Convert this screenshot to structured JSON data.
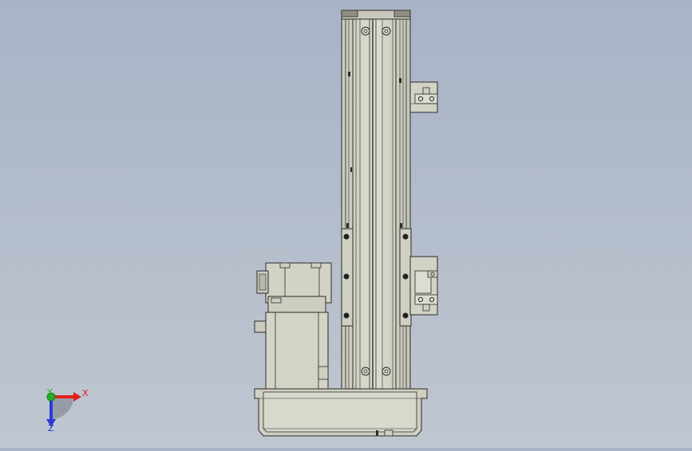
{
  "viewport": {
    "background_top": "#a8b3c6",
    "background_bottom": "#bfc6d0",
    "part_fill": "#d3d3c6",
    "part_shade": "#bdbdb0",
    "edge_color": "#2b2b2b"
  },
  "triad": {
    "x_label": "X",
    "y_label": "Y",
    "z_label": "Z",
    "x_color": "#e0201f",
    "y_color": "#22b022",
    "z_color": "#2a3bd6"
  }
}
